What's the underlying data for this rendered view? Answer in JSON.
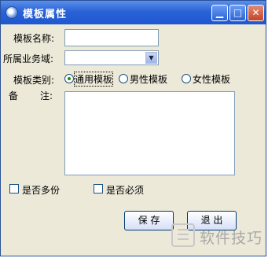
{
  "window": {
    "title": "模板属性"
  },
  "form": {
    "template_name_label": "模板名称:",
    "template_name_value": "",
    "business_domain_label": "所属业务域:",
    "business_domain_value": "",
    "template_type_label": "模板类别:",
    "type_options": [
      {
        "label": "通用模板",
        "checked": true
      },
      {
        "label": "男性模板",
        "checked": false
      },
      {
        "label": "女性模板",
        "checked": false
      }
    ],
    "remarks_label_1": "备",
    "remarks_label_2": "注:",
    "remarks_value": "",
    "multi_copy_label": "是否多份",
    "multi_copy_checked": false,
    "required_label": "是否必须",
    "required_checked": false
  },
  "buttons": {
    "save_label": "保 存",
    "exit_label": "退 出"
  },
  "watermark": {
    "text": "软件技巧"
  }
}
